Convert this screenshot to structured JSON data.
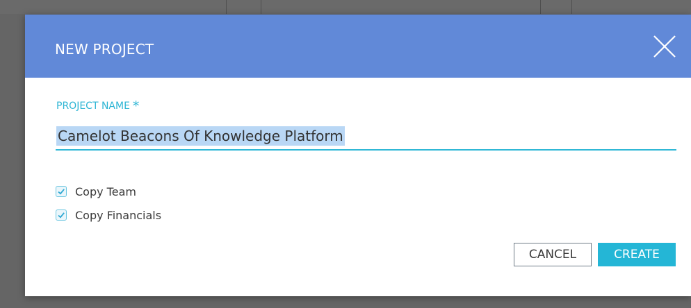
{
  "dialog": {
    "title": "NEW PROJECT",
    "close_icon": "close-icon",
    "project_name_label": "PROJECT NAME",
    "required_marker": "*",
    "project_name_value": "Camelot Beacons Of Knowledge Platform",
    "copy_team": {
      "label": "Copy Team",
      "checked": true
    },
    "copy_financials": {
      "label": "Copy Financials",
      "checked": true
    },
    "cancel_label": "CANCEL",
    "create_label": "CREATE"
  },
  "colors": {
    "header": "#6189d8",
    "accent": "#2db5d4",
    "create_button": "#24b6d6",
    "text_selection": "#b9d7f5"
  }
}
